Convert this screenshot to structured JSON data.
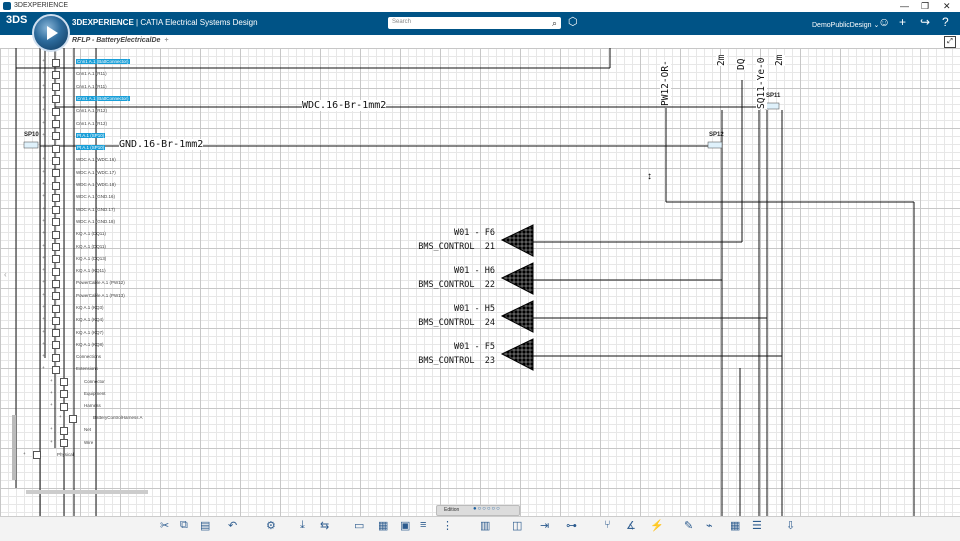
{
  "os_window": {
    "title": "3DEXPERIENCE",
    "controls": [
      "—",
      "❐",
      "✕"
    ]
  },
  "topbar": {
    "logo": "3DS",
    "brand_bold": "3DEXPERIENCE",
    "brand_rest": " | CATIA Electrical Systems Design",
    "search_placeholder": "Search",
    "user": "DemoPublicDesign",
    "icons": [
      "tag-icon",
      "user-icon",
      "add-icon",
      "share-icon",
      "help-icon"
    ]
  },
  "tab": {
    "label": "RFLP - BatteryElectricalDe",
    "plus": "+"
  },
  "tree": {
    "items": [
      "Cnn1 A.1 (BattConnector)",
      "Cnn1 A.1 (R11)",
      "Cnn1 A.1 (R11)",
      "Cnn1 A.1 (BattConnector)",
      "Cnn1 A.1 (R12)",
      "Cnn1 A.1 (R12)",
      "Pt A.1 (SP10)",
      "Pt A.1 (SP10)",
      "WDC A.1 (WDC.16)",
      "WDC A.1 (WDC.17)",
      "WDC A.1 (WDC.18)",
      "WDC A.1 (GND.16)",
      "WDC A.1 (GND.17)",
      "WDC A.1 (GND.18)",
      "KQ A.1 (DQ11)",
      "KQ A.1 (DQ11)",
      "KQ A.1 (DQ13)",
      "KQ A.1 (KQ11)",
      "PowerCable A.1 (PW12)",
      "PowerCable A.1 (PW13)",
      "KQ A.1 (KQ3)",
      "KQ A.1 (KQ4)",
      "KQ A.1 (KQ7)",
      "KQ A.1 (KQ8)",
      "Connections",
      "Extensions",
      "Connector",
      "Equipment",
      "Harness",
      "BatteryControlHarness A",
      "Net",
      "Wire",
      "Physical"
    ],
    "selected": [
      0,
      3,
      6,
      7
    ]
  },
  "schematic": {
    "wires": [
      "WDC.16-Br-1mm2",
      "GND.16-Br-1mm2"
    ],
    "vertical_labels": [
      "PW12-OR-",
      "2m",
      "DQ",
      "SQ11-Ye-0",
      "2m"
    ],
    "splices": [
      "SP10",
      "SP12",
      "SP11"
    ],
    "connectors": [
      {
        "wire": "W01 - F6",
        "signal": "BMS_CONTROL",
        "pin": "21"
      },
      {
        "wire": "W01 - H6",
        "signal": "BMS_CONTROL",
        "pin": "22"
      },
      {
        "wire": "W01 - H5",
        "signal": "BMS_CONTROL",
        "pin": "24"
      },
      {
        "wire": "W01 - F5",
        "signal": "BMS_CONTROL",
        "pin": "23"
      }
    ]
  },
  "edition_bar": {
    "label": "Edition"
  },
  "toolbar_icons": [
    "cut-icon",
    "copy-icon",
    "paste-icon",
    "undo-icon",
    "settings-icon",
    "insert-icon",
    "replace-icon",
    "view-icon",
    "frame-icon",
    "display-icon",
    "align-icon",
    "distribute-icon",
    "table-icon",
    "panel-icon",
    "route-icon",
    "connect-icon",
    "branch-icon",
    "measure-icon",
    "analyze-icon",
    "tools-icon",
    "wire-icon",
    "grid-icon",
    "list-icon",
    "export-icon"
  ]
}
